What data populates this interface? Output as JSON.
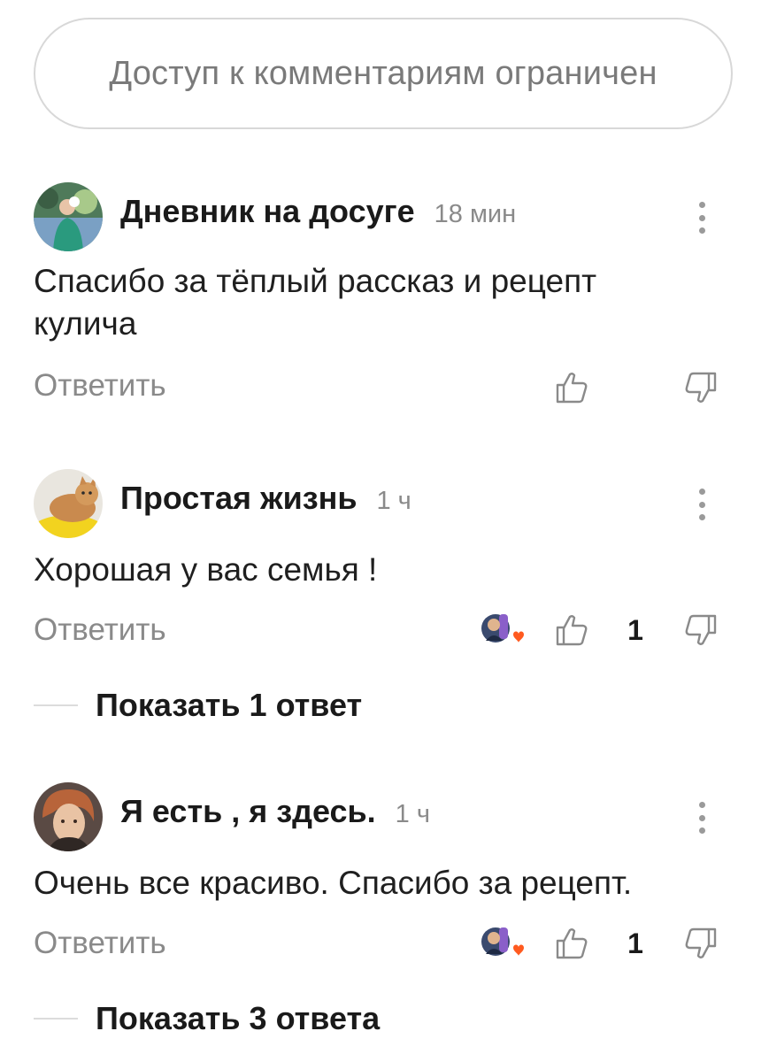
{
  "restricted_notice": "Доступ к комментариям ограничен",
  "comments": [
    {
      "author": "Дневник на досуге",
      "time": "18 мин",
      "text": "Спасибо за тёплый рассказ и рецепт кулича",
      "reply_label": "Ответить",
      "likes": ""
    },
    {
      "author": "Простая жизнь",
      "time": "1 ч",
      "text": "Хорошая у вас семья !",
      "reply_label": "Ответить",
      "likes": "1",
      "show_replies": "Показать 1 ответ"
    },
    {
      "author": "Я есть , я здесь.",
      "time": "1 ч",
      "text": "Очень все красиво. Спасибо за рецепт.",
      "reply_label": "Ответить",
      "likes": "1",
      "show_replies": "Показать 3 ответа"
    }
  ],
  "icons": {
    "like": "thumbs-up-icon",
    "dislike": "thumbs-down-icon",
    "more": "more-vertical-icon",
    "heart": "heart-icon"
  },
  "colors": {
    "heart": "#ff5a1f",
    "text_muted": "#8a8a8a",
    "border": "#d8d8d8"
  }
}
